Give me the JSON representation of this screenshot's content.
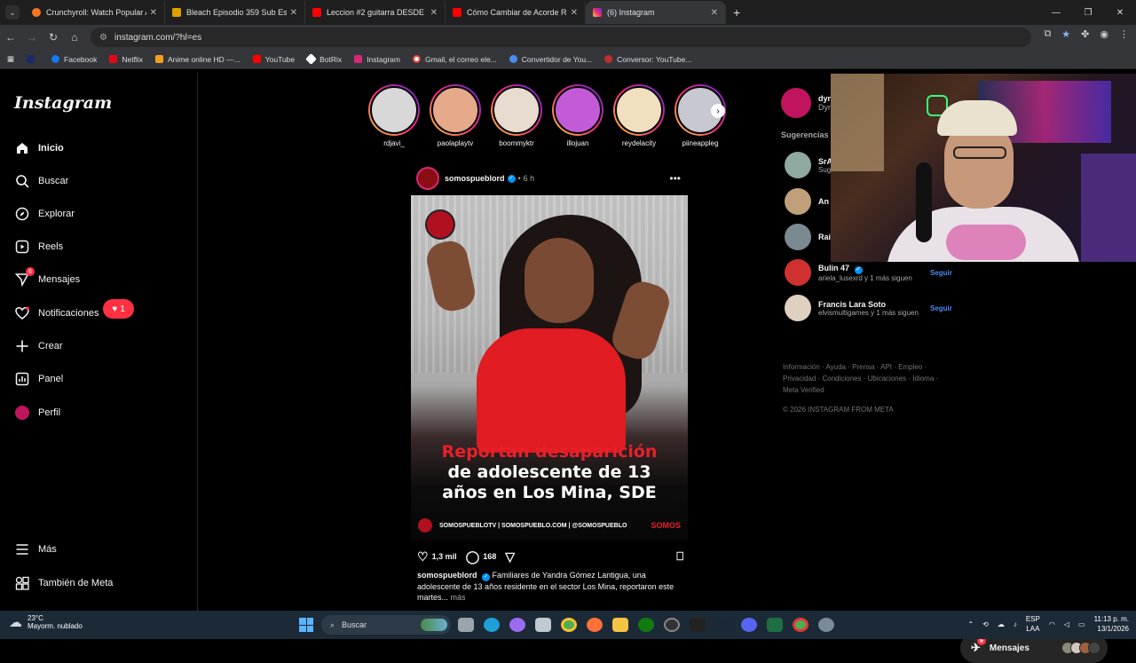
{
  "browser": {
    "tabs": [
      {
        "label": "Crunchyroll: Watch Popular Ani",
        "color": "#f47521"
      },
      {
        "label": "Bleach Episodio 359 Sub Españ",
        "color": "#e0a000"
      },
      {
        "label": "Leccion #2 guitarra DESDE CER",
        "color": "#ff0000"
      },
      {
        "label": "Cómo Cambiar de Acorde Rápi",
        "color": "#ff0000"
      },
      {
        "label": "(6) Instagram",
        "color": "#d62976"
      }
    ],
    "url": "instagram.com/?hl=es",
    "bookmarks": [
      {
        "label": "",
        "color": "#1a2a6a"
      },
      {
        "label": "Facebook",
        "color": "#1877f2"
      },
      {
        "label": "Netflix",
        "color": "#e50914"
      },
      {
        "label": "Anime online HD —...",
        "color": "#f0a020"
      },
      {
        "label": "YouTube",
        "color": "#ff0000"
      },
      {
        "label": "BotRix",
        "color": "#ffffff"
      },
      {
        "label": "Instagram",
        "color": "#d62976"
      },
      {
        "label": "Gmail, el correo ele...",
        "color": "#ea4335"
      },
      {
        "label": "Convertidor de You...",
        "color": "#4a8cf0"
      },
      {
        "label": "Conversor: YouTube...",
        "color": "#c03030"
      }
    ]
  },
  "instagram": {
    "logo": "Instagram",
    "nav": {
      "home": "Inicio",
      "search": "Buscar",
      "explore": "Explorar",
      "reels": "Reels",
      "messages": "Mensajes",
      "messages_badge": "6",
      "notifications": "Notificaciones",
      "notifications_count": "1",
      "create": "Crear",
      "dashboard": "Panel",
      "profile": "Perfil",
      "more": "Más",
      "meta": "También de Meta"
    },
    "stories": [
      {
        "user": "rdjavi_",
        "color": "#d8d8d8"
      },
      {
        "user": "paolaplaytv",
        "color": "#e6a98a"
      },
      {
        "user": "boommyktr",
        "color": "#e8dcd0"
      },
      {
        "user": "illojuan",
        "color": "#c35bd8"
      },
      {
        "user": "reydelacity",
        "color": "#f0e0c0"
      },
      {
        "user": "piineappleg",
        "color": "#c8c8d0"
      }
    ],
    "post": {
      "user": "somospueblord",
      "time": "6 h",
      "headline_red": "Reportan desaparición",
      "headline_white_1": "de adolescente de 13",
      "headline_white_2": "años en Los Mina, SDE",
      "footer_text": "SOMOSPUEBLOTV | SOMOSPUEBLO.COM | @SOMOSPUEBLO",
      "footer_brand": "SOMOS",
      "likes": "1,3 mil",
      "comments": "168",
      "caption_user": "somospueblord",
      "caption": "Familiares de Yandra Gómez Lantigua, una adolescente de 13 años residente en el sector Los Mina, reportaron este martes...",
      "more": "más"
    },
    "me": {
      "name": "dyn",
      "sub": "Dyn"
    },
    "suggestions_title": "Sugerencias",
    "suggestions": [
      {
        "name": "SrA",
        "sub": "Sug",
        "follow": "",
        "color": "#8fa8a0"
      },
      {
        "name": "An",
        "sub": "",
        "follow": "",
        "color": "#c0a07a"
      },
      {
        "name": "Rai",
        "sub": "",
        "follow": "",
        "color": "#7a8a90"
      },
      {
        "name": "Bulin 47",
        "sub": "ariela_lusexrd y 1 más siguen",
        "follow": "Seguir",
        "color": "#d03030"
      },
      {
        "name": "Francis Lara Soto",
        "sub": "elvismultigames y 1 más siguen",
        "follow": "Seguir",
        "color": "#e0d0c0"
      }
    ],
    "footer_links": "Información · Ayuda · Prensa · API · Empleo · Privacidad · Condiciones · Ubicaciones · Idioma · Meta Verified",
    "copyright": "© 2026 INSTAGRAM FROM META",
    "messages_pill": {
      "label": "Mensajes",
      "badge": "6"
    }
  },
  "taskbar": {
    "temp": "23°C",
    "weather": "Mayorm. nublado",
    "search": "Buscar",
    "lang_1": "ESP",
    "lang_2": "LAA",
    "time": "11:13 p. m.",
    "date": "13/1/2026"
  }
}
